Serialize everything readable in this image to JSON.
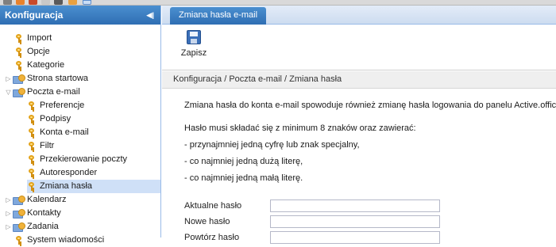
{
  "sidebar": {
    "title": "Konfiguracja",
    "collapse_icon": "double-chevron-left-icon",
    "items": [
      {
        "label": "Import",
        "icon": "key-icon",
        "level": 1
      },
      {
        "label": "Opcje",
        "icon": "key-icon",
        "level": 1
      },
      {
        "label": "Kategorie",
        "icon": "key-icon",
        "level": 1
      },
      {
        "label": "Strona startowa",
        "icon": "folder-settings-icon",
        "level": 0,
        "expand": "collapsed"
      },
      {
        "label": "Poczta e-mail",
        "icon": "folder-settings-icon",
        "level": 0,
        "expand": "expanded"
      },
      {
        "label": "Preferencje",
        "icon": "key-icon",
        "level": 2
      },
      {
        "label": "Podpisy",
        "icon": "key-icon",
        "level": 2
      },
      {
        "label": "Konta e-mail",
        "icon": "key-icon",
        "level": 2
      },
      {
        "label": "Filtr",
        "icon": "key-icon",
        "level": 2
      },
      {
        "label": "Przekierowanie poczty",
        "icon": "key-icon",
        "level": 2
      },
      {
        "label": "Autoresponder",
        "icon": "key-icon",
        "level": 2
      },
      {
        "label": "Zmiana hasła",
        "icon": "key-icon",
        "level": 2,
        "selected": true
      },
      {
        "label": "Kalendarz",
        "icon": "folder-settings-icon",
        "level": 0,
        "expand": "collapsed"
      },
      {
        "label": "Kontakty",
        "icon": "folder-settings-icon",
        "level": 0,
        "expand": "collapsed"
      },
      {
        "label": "Zadania",
        "icon": "folder-settings-icon",
        "level": 0,
        "expand": "collapsed"
      },
      {
        "label": "System wiadomości",
        "icon": "key-icon",
        "level": 1
      }
    ]
  },
  "main": {
    "tab_label": "Zmiana hasła e-mail",
    "toolbar": {
      "save_label": "Zapisz",
      "save_icon": "floppy-disk-icon"
    },
    "breadcrumb": "Konfiguracja / Poczta e-mail / Zmiana hasła",
    "intro": "Zmiana hasła do konta e-mail spowoduje również zmianę hasła logowania do panelu Active.office",
    "rules_title": "Hasło musi składać się z minimum 8 znaków oraz zawierać:",
    "rules": [
      "- przynajmniej jedną cyfrę lub znak specjalny,",
      "- co najmniej jedną dużą literę,",
      "- co najmniej jedną małą literę."
    ],
    "form": {
      "current_label": "Aktualne hasło",
      "current_value": "",
      "new_label": "Nowe hasło",
      "new_value": "",
      "repeat_label": "Powtórz hasło",
      "repeat_value": ""
    }
  },
  "colors": {
    "header_blue": "#2f6eb3",
    "selected_row": "#cfe0f7",
    "key_gold": "#e3a31a"
  }
}
